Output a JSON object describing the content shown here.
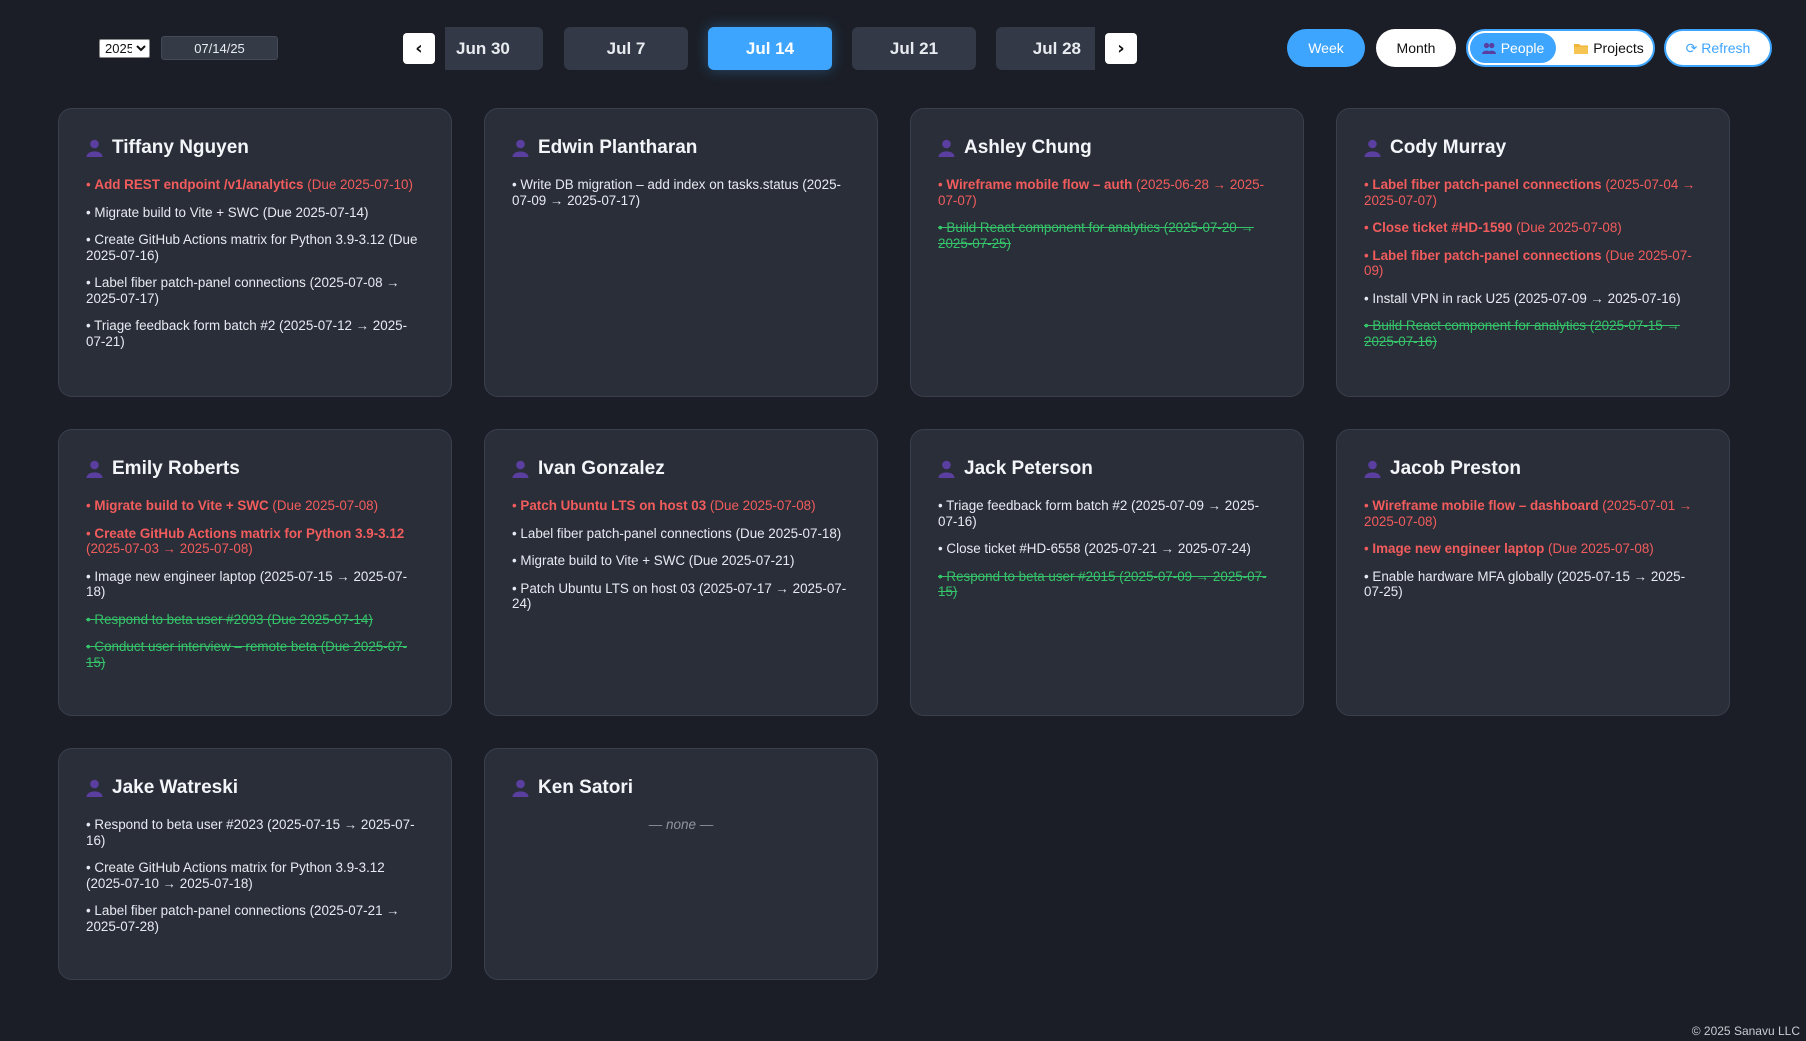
{
  "toolbar": {
    "year": "2025",
    "year_options": [
      "2025"
    ],
    "date_value": "07/14/25",
    "prev_label": "‹",
    "next_label": "›",
    "weeks": [
      "Jun 30",
      "Jul 7",
      "Jul 14",
      "Jul 21",
      "Jul 28"
    ],
    "active_week": "Jul 14",
    "view_week": "Week",
    "view_month": "Month",
    "people": "People",
    "projects": "Projects",
    "refresh": "⟳ Refresh"
  },
  "colors": {
    "accent": "#3ea5ff",
    "overdue": "#f25c5c",
    "done": "#35c46a",
    "card_bg": "#2a2e39",
    "page_bg": "#1b1e26"
  },
  "people": [
    {
      "name": "Tiffany Nguyen",
      "tasks": [
        {
          "status": "overdue",
          "title": "Add REST endpoint /v1/analytics",
          "meta": " (Due 2025-07-10)"
        },
        {
          "status": "normal",
          "title": "Migrate build to Vite + SWC",
          "meta": " (Due 2025-07-14)"
        },
        {
          "status": "normal",
          "title": "Create GitHub Actions matrix for Python 3.9-3.12",
          "meta": " (Due 2025-07-16)"
        },
        {
          "status": "normal",
          "title": "Label fiber patch-panel connections",
          "meta": " (2025-07-08 → 2025-07-17)"
        },
        {
          "status": "normal",
          "title": "Triage feedback form batch #2",
          "meta": " (2025-07-12 → 2025-07-21)"
        }
      ]
    },
    {
      "name": "Edwin Plantharan",
      "tasks": [
        {
          "status": "normal",
          "title": "Write DB migration – add index on tasks.status",
          "meta": " (2025-07-09 → 2025-07-17)"
        }
      ]
    },
    {
      "name": "Ashley Chung",
      "tasks": [
        {
          "status": "overdue",
          "title": "Wireframe mobile flow – auth",
          "meta": " (2025-06-28 → 2025-07-07)"
        },
        {
          "status": "done",
          "title": "Build React component for analytics",
          "meta": " (2025-07-20 → 2025-07-25)"
        }
      ]
    },
    {
      "name": "Cody Murray",
      "tasks": [
        {
          "status": "overdue",
          "title": "Label fiber patch-panel connections",
          "meta": " (2025-07-04 → 2025-07-07)"
        },
        {
          "status": "overdue",
          "title": "Close ticket #HD-1590",
          "meta": " (Due 2025-07-08)"
        },
        {
          "status": "overdue",
          "title": "Label fiber patch-panel connections",
          "meta": " (Due 2025-07-09)"
        },
        {
          "status": "normal",
          "title": "Install VPN in rack U25",
          "meta": " (2025-07-09 → 2025-07-16)"
        },
        {
          "status": "done",
          "title": "Build React component for analytics",
          "meta": " (2025-07-15 → 2025-07-16)"
        }
      ]
    },
    {
      "name": "Emily Roberts",
      "tasks": [
        {
          "status": "overdue",
          "title": "Migrate build to Vite + SWC",
          "meta": " (Due 2025-07-08)"
        },
        {
          "status": "overdue",
          "title": "Create GitHub Actions matrix for Python 3.9-3.12",
          "meta": " (2025-07-03 → 2025-07-08)"
        },
        {
          "status": "normal",
          "title": "Image new engineer laptop",
          "meta": " (2025-07-15 → 2025-07-18)"
        },
        {
          "status": "done",
          "title": "Respond to beta user #2093",
          "meta": " (Due 2025-07-14)"
        },
        {
          "status": "done",
          "title": "Conduct user interview – remote beta",
          "meta": " (Due 2025-07-15)"
        }
      ]
    },
    {
      "name": "Ivan Gonzalez",
      "tasks": [
        {
          "status": "overdue",
          "title": "Patch Ubuntu LTS on host 03",
          "meta": " (Due 2025-07-08)"
        },
        {
          "status": "normal",
          "title": "Label fiber patch-panel connections",
          "meta": " (Due 2025-07-18)"
        },
        {
          "status": "normal",
          "title": "Migrate build to Vite + SWC",
          "meta": " (Due 2025-07-21)"
        },
        {
          "status": "normal",
          "title": "Patch Ubuntu LTS on host 03",
          "meta": " (2025-07-17 → 2025-07-24)"
        }
      ]
    },
    {
      "name": "Jack Peterson",
      "tasks": [
        {
          "status": "normal",
          "title": "Triage feedback form batch #2",
          "meta": " (2025-07-09 → 2025-07-16)"
        },
        {
          "status": "normal",
          "title": "Close ticket #HD-6558",
          "meta": " (2025-07-21 → 2025-07-24)"
        },
        {
          "status": "done",
          "title": "Respond to beta user #2015",
          "meta": " (2025-07-09 → 2025-07-15)"
        }
      ]
    },
    {
      "name": "Jacob Preston",
      "tasks": [
        {
          "status": "overdue",
          "title": "Wireframe mobile flow – dashboard",
          "meta": " (2025-07-01 → 2025-07-08)"
        },
        {
          "status": "overdue",
          "title": "Image new engineer laptop",
          "meta": " (Due 2025-07-08)"
        },
        {
          "status": "normal",
          "title": "Enable hardware MFA globally",
          "meta": " (2025-07-15 → 2025-07-25)"
        }
      ]
    },
    {
      "name": "Jake Watreski",
      "tasks": [
        {
          "status": "normal",
          "title": "Respond to beta user #2023",
          "meta": " (2025-07-15 → 2025-07-16)"
        },
        {
          "status": "normal",
          "title": "Create GitHub Actions matrix for Python 3.9-3.12",
          "meta": " (2025-07-10 → 2025-07-18)"
        },
        {
          "status": "normal",
          "title": "Label fiber patch-panel connections",
          "meta": " (2025-07-21 → 2025-07-28)"
        }
      ]
    },
    {
      "name": "Ken Satori",
      "tasks": [],
      "empty_text": "— none —"
    }
  ],
  "footer": "© 2025 Sanavu LLC"
}
